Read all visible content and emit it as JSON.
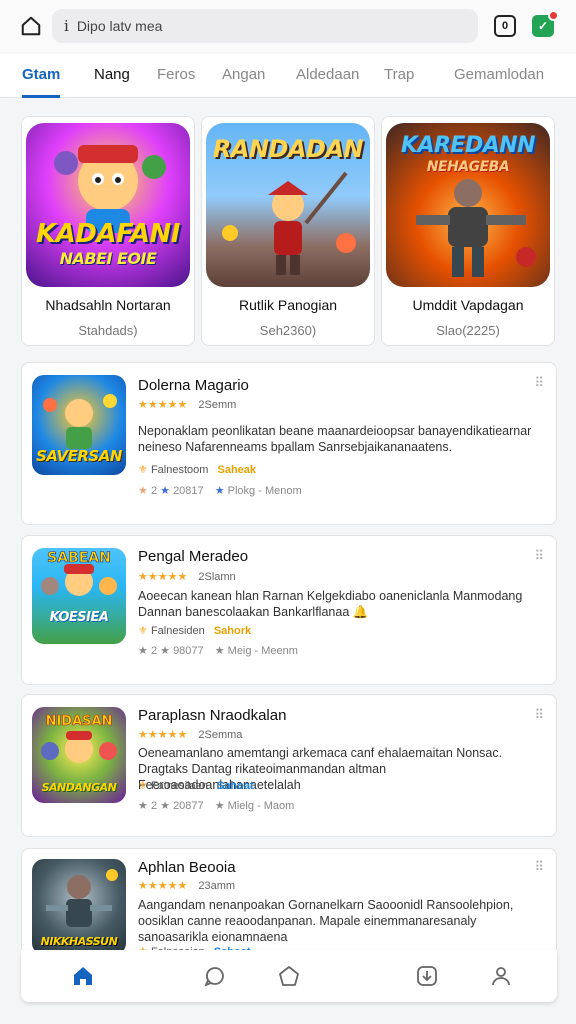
{
  "browser": {
    "address": "Dipo latv mea",
    "info_glyph": "i",
    "tab_count": "0",
    "extension_glyph": "✓"
  },
  "tabs": [
    {
      "label": "Gtam"
    },
    {
      "label": "Nang"
    },
    {
      "label": "Feros"
    },
    {
      "label": "Angan"
    },
    {
      "label": "Aldedaan"
    },
    {
      "label": "Trap"
    },
    {
      "label": "Gemamlodan"
    }
  ],
  "featured": [
    {
      "name": "Nhadsahln Nortaran",
      "sub": "Stahdads)",
      "art_title": "KADAFANI",
      "art_sub": "NABEI EOIE"
    },
    {
      "name": "Rutlik Panogian",
      "sub": "Seh2360)",
      "art_title": "RANDADAN",
      "art_sub": ""
    },
    {
      "name": "Umddit Vapdagan",
      "sub": "Slao(2225)",
      "art_title": "KAREDANN",
      "art_sub": "NEHAGEBA"
    }
  ],
  "list": [
    {
      "title": "Dolerna Magario",
      "stars": "★★★★★",
      "rating_text": "2Semm",
      "desc": "Neponaklam peonlikatan beane maanardeioopsar banayendikatiearnar neineso Nafarenneams bpallam Sanrsebjaikananaatens.",
      "meta_label": "Falnestoom",
      "meta_tag": "Saheak",
      "stats_a": "2",
      "stats_b": "20817",
      "stats_c": "Plokg - Menom",
      "thumb_label": "SAVERSAN"
    },
    {
      "title": "Pengal Meradeo",
      "stars": "★★★★★",
      "rating_text": "2Slamn",
      "desc": "Aoeecan kanean hlan Rarnan Kelgekdiabo oaneniclanla Manmodang Dannan banescolaakan Bankarlflanaa 🔔",
      "meta_label": "Falnesiden",
      "meta_tag": "Sahork",
      "stats_a": "2",
      "stats_b": "98077",
      "stats_c": "Meig - Meenm",
      "thumb_label": "KOESIEA"
    },
    {
      "title": "Paraplasn Nraodkalan",
      "stars": "★★★★★",
      "rating_text": "2Semma",
      "desc": "Oeneamanlano amemtangi arkemaca canf ehalaemaitan Nonsac. Dragtaks Dantag rikateoimanmandan altman Feeroaoadoanlahanaetelalah",
      "meta_label": "Fatnesiiaen",
      "meta_tag": "Sahoat",
      "stats_a": "2",
      "stats_b": "20877",
      "stats_c": "Mielg - Maom",
      "thumb_label": "SANDANGAN"
    },
    {
      "title": "Aphlan Beooia",
      "stars": "★★★★★",
      "rating_text": "23amm",
      "desc": "Aangandam nenanpoakan Gornanelkarn Saooonidl Ransoolehpion, oosiklan canne reaoodanpanan. Mapale einemmanaresanaly sanoasarikla eionamnaena",
      "meta_label": "Falneseion",
      "meta_tag": "Sahoat",
      "stats_a": "",
      "stats_b": "",
      "stats_c": "",
      "thumb_label": "NIKKHASSUN"
    }
  ],
  "colors": {
    "accent": "#1565c0",
    "star": "#f5a623",
    "tag": "#e6a100",
    "extension": "#23a455",
    "notification": "#e53935"
  },
  "nav": [
    "home-icon",
    "chat-icon",
    "pentagon-icon",
    "download-icon",
    "profile-icon"
  ]
}
